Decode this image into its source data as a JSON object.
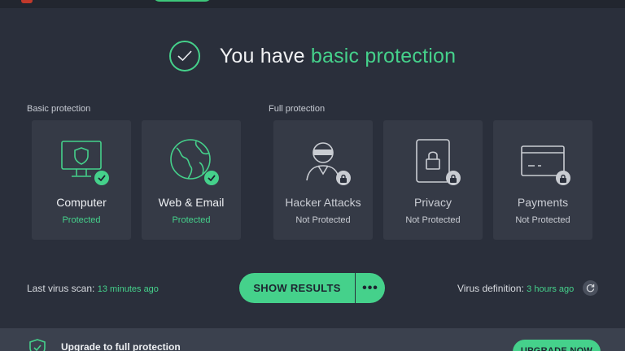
{
  "hero": {
    "title_prefix": "You have ",
    "title_accent": "basic protection"
  },
  "sections": {
    "basic_label": "Basic protection",
    "full_label": "Full protection"
  },
  "cards": [
    {
      "title": "Computer",
      "status": "Protected",
      "icon": "monitor-shield-icon",
      "state": "protected"
    },
    {
      "title": "Web & Email",
      "status": "Protected",
      "icon": "globe-icon",
      "state": "protected"
    },
    {
      "title": "Hacker Attacks",
      "status": "Not Protected",
      "icon": "hacker-icon",
      "state": "locked"
    },
    {
      "title": "Privacy",
      "status": "Not Protected",
      "icon": "privacy-lock-icon",
      "state": "locked"
    },
    {
      "title": "Payments",
      "status": "Not Protected",
      "icon": "credit-card-icon",
      "state": "locked"
    }
  ],
  "scan": {
    "label": "Last virus scan: ",
    "value": "13 minutes ago"
  },
  "actions": {
    "show_results": "SHOW RESULTS",
    "more": "•••"
  },
  "definitions": {
    "label": "Virus definition: ",
    "value": "3 hours ago"
  },
  "upgrade": {
    "text": "Upgrade to full protection",
    "button": "UPGRADE NOW"
  },
  "colors": {
    "accent": "#45d18b",
    "background": "#2a2f3b",
    "card": "#353a46"
  }
}
